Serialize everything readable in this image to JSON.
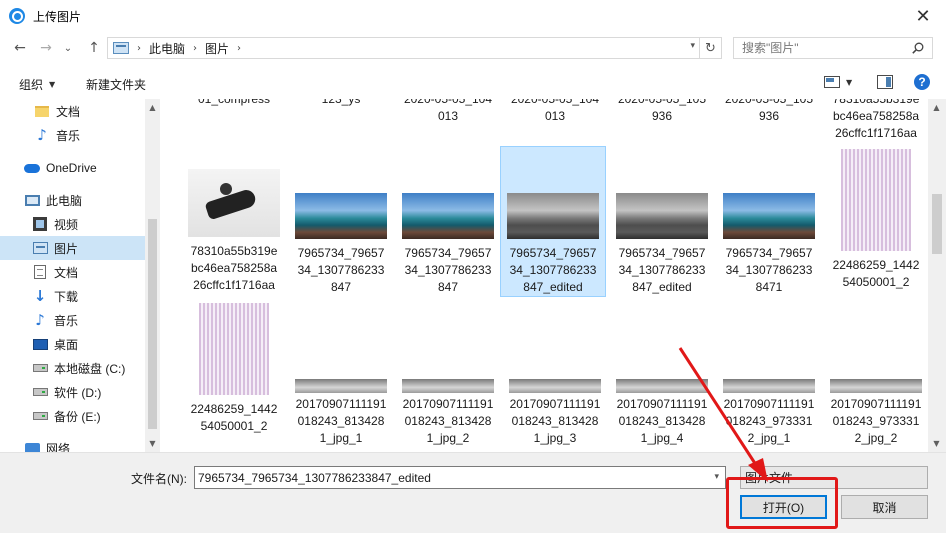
{
  "window": {
    "title": "上传图片",
    "close_glyph": "✕"
  },
  "navigation": {
    "back_glyph": "←",
    "forward_glyph": "→",
    "recent_glyph": "⌄",
    "up_glyph": "↑",
    "breadcrumb": [
      "此电脑",
      "图片"
    ],
    "refresh_glyph": "↻",
    "search_placeholder": "搜索\"图片\""
  },
  "toolbar": {
    "organize": "组织",
    "new_folder": "新建文件夹"
  },
  "sidebar": {
    "items": [
      {
        "label": "文档",
        "icon": "folder-icon"
      },
      {
        "label": "音乐",
        "icon": "music-icon"
      },
      {
        "label": "OneDrive",
        "icon": "cloud-icon"
      },
      {
        "label": "此电脑",
        "icon": "computer-icon"
      },
      {
        "label": "视频",
        "icon": "video-icon"
      },
      {
        "label": "图片",
        "icon": "pictures-icon",
        "selected": true
      },
      {
        "label": "文档",
        "icon": "document-icon"
      },
      {
        "label": "下载",
        "icon": "download-icon"
      },
      {
        "label": "音乐",
        "icon": "music-icon"
      },
      {
        "label": "桌面",
        "icon": "desktop-icon"
      },
      {
        "label": "本地磁盘 (C:)",
        "icon": "disk-icon"
      },
      {
        "label": "软件 (D:)",
        "icon": "disk-icon"
      },
      {
        "label": "备份 (E:)",
        "icon": "disk-icon"
      },
      {
        "label": "网络",
        "icon": "network-icon"
      }
    ]
  },
  "files": {
    "row0": [
      "01_compress",
      "123_ys",
      "2020-05-05_104\n013",
      "2020-05-05_104\n013",
      "2020-05-05_105\n936",
      "2020-05-05_105\n936",
      "78310a55b319e\nbc46ea758258a\n26cffc1f1716aa"
    ],
    "row1": [
      {
        "name": "78310a55b319e\nbc46ea758258a\n26cffc1f1716aa",
        "thumb": "headset"
      },
      {
        "name": "7965734_79657\n34_1307786233\n847",
        "thumb": "sea"
      },
      {
        "name": "7965734_79657\n34_1307786233\n847",
        "thumb": "sea"
      },
      {
        "name": "7965734_79657\n34_1307786233\n847_edited",
        "thumb": "sea-bw",
        "selected": true
      },
      {
        "name": "7965734_79657\n34_1307786233\n847_edited",
        "thumb": "sea-bw"
      },
      {
        "name": "7965734_79657\n34_1307786233\n8471",
        "thumb": "sea"
      },
      {
        "name": "22486259_1442\n54050001_2",
        "thumb": "stripes"
      }
    ],
    "row2": [
      {
        "name": "22486259_1442\n54050001_2",
        "thumb": "stripes"
      },
      {
        "name": "20170907111191\n018243_813428\n1_jpg_1",
        "thumb": "strip"
      },
      {
        "name": "20170907111191\n018243_813428\n1_jpg_2",
        "thumb": "strip"
      },
      {
        "name": "20170907111191\n018243_813428\n1_jpg_3",
        "thumb": "strip"
      },
      {
        "name": "20170907111191\n018243_813428\n1_jpg_4",
        "thumb": "strip"
      },
      {
        "name": "20170907111191\n018243_973331\n2_jpg_1",
        "thumb": "strip"
      },
      {
        "name": "20170907111191\n018243_973331\n2_jpg_2",
        "thumb": "strip"
      }
    ]
  },
  "footer": {
    "filename_label": "文件名(N):",
    "filename_value": "7965734_7965734_1307786233847_edited",
    "filetype_value": "图片文件",
    "open_button": "打开(O)",
    "cancel_button": "取消"
  },
  "colors": {
    "selection": "#cce8ff",
    "annotation": "#e11818",
    "accent": "#0078d7"
  }
}
